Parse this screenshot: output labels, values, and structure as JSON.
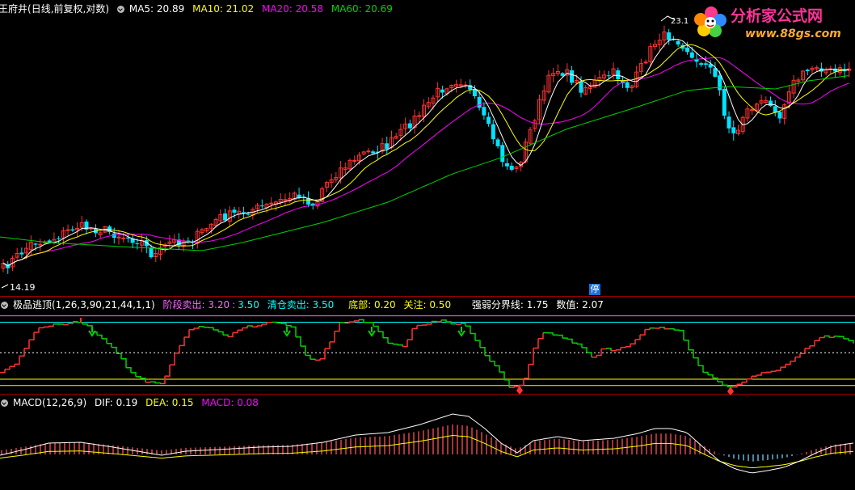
{
  "colors": {
    "up": "#ff3232",
    "down": "#00e5ff",
    "ma5": "#ffffff",
    "ma10": "#ffff00",
    "ma20": "#ff00ff",
    "ma60": "#00d200",
    "divider": "#a00000",
    "dif": "#ffffff",
    "dea": "#ffff00",
    "macd_label": "#ff00ff",
    "escape_up": "#ff3232",
    "escape_down": "#00d200",
    "signal_down": "#00d200",
    "signal_up": "#ff3232",
    "line_sell": "#ff66ff",
    "line_clear": "#00ffff",
    "line_bottom": "#ffff00",
    "line_strength": "#ffffff"
  },
  "header_main": {
    "stock_name": "王府井",
    "mode": "(日线,前复权,对数)",
    "ma5": "MA5: 20.89",
    "ma10": "MA10: 21.02",
    "ma20": "MA20: 20.58",
    "ma60": "MA60: 20.69"
  },
  "header_ind": {
    "name": "极品逃顶(1,26,3,90,21,44,1,1)",
    "stage_label": "阶段卖出: ",
    "stage_value": "3.20",
    "sep": ":",
    "stage_value2": "3.50",
    "clear_label": "清仓卖出: ",
    "clear_value": "3.50",
    "bottom_label": "底部: ",
    "bottom_value": "0.20",
    "focus_label": "关注: ",
    "focus_value": "0.50",
    "strength_label": "强弱分界线: ",
    "strength_value": "1.75",
    "num_label": "数值: ",
    "num_value": "2.07"
  },
  "header_macd": {
    "name": "MACD(12,26,9)",
    "dif": "DIF: 0.19",
    "dea": "DEA: 0.15",
    "macd": "MACD: 0.08"
  },
  "logo": {
    "text": "分析家公式网",
    "url": "www.88gs.com"
  },
  "stop_mark": "停",
  "chart_data": [
    {
      "type": "candlestick",
      "title": "王府井 (日线,前复权,对数)",
      "high_label": "23.1",
      "high_value": 23.1,
      "low_label": "14.19",
      "low_value": 14.19,
      "ylim": [
        14.19,
        23.1
      ],
      "ma_values": {
        "MA5": 20.89,
        "MA10": 21.02,
        "MA20": 20.58,
        "MA60": 20.69
      }
    },
    {
      "type": "line",
      "title": "极品逃顶(1,26,3,90,21,44,1,1)",
      "levels": {
        "阶段卖出": 3.2,
        "清仓卖出": 3.5,
        "底部": 0.2,
        "关注": 0.5,
        "强弱分界线": 1.75
      },
      "last_value": 2.07,
      "ylim": [
        0,
        3.6
      ]
    },
    {
      "type": "line",
      "title": "MACD(12,26,9)",
      "DIF": 0.19,
      "DEA": 0.15,
      "MACD": 0.08
    }
  ]
}
